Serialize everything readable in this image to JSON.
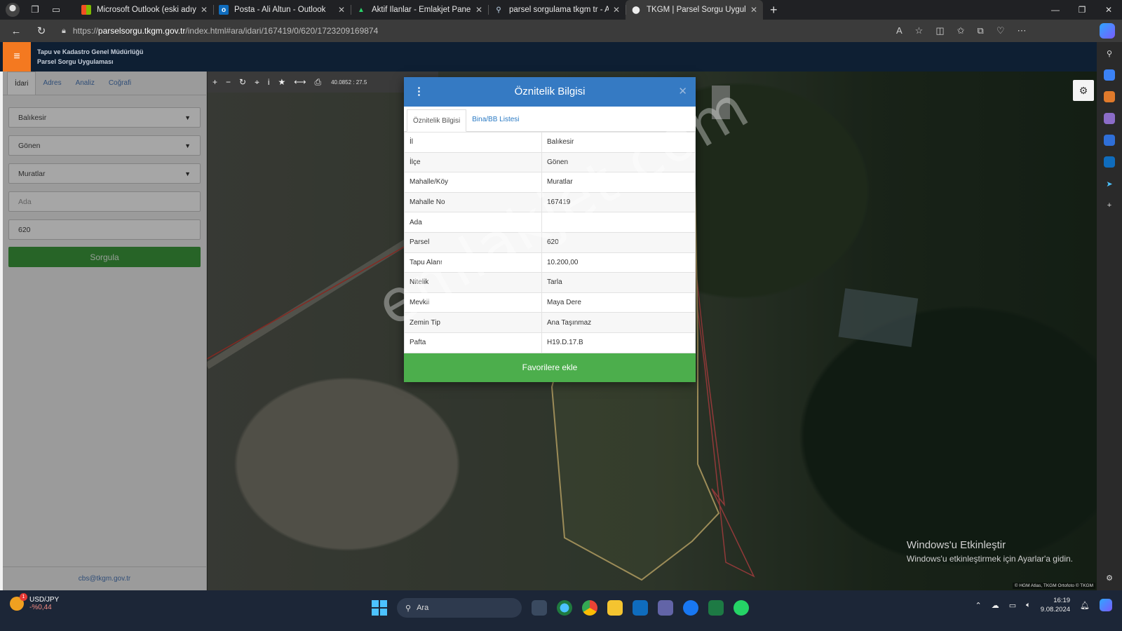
{
  "browser": {
    "tabs": [
      {
        "title": "Microsoft Outlook (eski adıyla Ho",
        "icon": "microsoft-icon",
        "active": false
      },
      {
        "title": "Posta - Ali Altun - Outlook",
        "icon": "outlook-icon",
        "active": false
      },
      {
        "title": "Aktif İlanlar - Emlakjet Panel",
        "icon": "emlakjet-icon",
        "active": false
      },
      {
        "title": "parsel sorgulama tkgm tr - Aram",
        "icon": "search-icon",
        "active": false
      },
      {
        "title": "TKGM | Parsel Sorgu Uygulaması",
        "icon": "pin-icon",
        "active": true
      }
    ],
    "url_prefix": "https://",
    "url_host": "parselsorgu.tkgm.gov.tr",
    "url_path": "/index.html#ara/idari/167419/0/620/1723209169874"
  },
  "app": {
    "header_line1": "Tapu ve Kadastro Genel Müdürlüğü",
    "header_line2": "Parsel Sorgu Uygulaması"
  },
  "left_panel": {
    "tabs": [
      "İdari",
      "Adres",
      "Analiz",
      "Coğrafi"
    ],
    "il": "Balıkesir",
    "ilce": "Gönen",
    "mahalle": "Muratlar",
    "ada_placeholder": "Ada",
    "parsel_value": "620",
    "submit_label": "Sorgula",
    "footer": "cbs@tkgm.gov.tr"
  },
  "map": {
    "coord_text": "40.0852 : 27.5",
    "attribution": "© HGM Atlas, TKGM Ortofoto © TKGM",
    "activate_title": "Windows'u Etkinleştir",
    "activate_sub": "Windows'u etkinleştirmek için Ayarlar'a gidin.",
    "watermark": "emlakjet.com"
  },
  "modal": {
    "title": "Öznitelik Bilgisi",
    "tabs": [
      "Öznitelik Bilgisi",
      "Bina/BB Listesi"
    ],
    "rows": [
      {
        "k": "İl",
        "v": "Balıkesir"
      },
      {
        "k": "İlçe",
        "v": "Gönen"
      },
      {
        "k": "Mahalle/Köy",
        "v": "Muratlar"
      },
      {
        "k": "Mahalle No",
        "v": "167419"
      },
      {
        "k": "Ada",
        "v": ""
      },
      {
        "k": "Parsel",
        "v": "620"
      },
      {
        "k": "Tapu Alanı",
        "v": "10.200,00"
      },
      {
        "k": "Nitelik",
        "v": "Tarla"
      },
      {
        "k": "Mevkii",
        "v": "Maya Dere"
      },
      {
        "k": "Zemin Tip",
        "v": "Ana Taşınmaz"
      },
      {
        "k": "Pafta",
        "v": "H19.D.17.B"
      }
    ],
    "button": "Favorilere ekle"
  },
  "taskbar": {
    "ticker_symbol": "USD/JPY",
    "ticker_change": "-%0,44",
    "ticker_badge": "1",
    "search_placeholder": "Ara",
    "time": "16:19",
    "date": "9.08.2024"
  },
  "colors": {
    "header_bg": "#0e1f33",
    "menu_accent": "#f47920",
    "modal_header": "#357ac3",
    "primary_green": "#4cae4c",
    "link_blue": "#2a7ac4"
  }
}
